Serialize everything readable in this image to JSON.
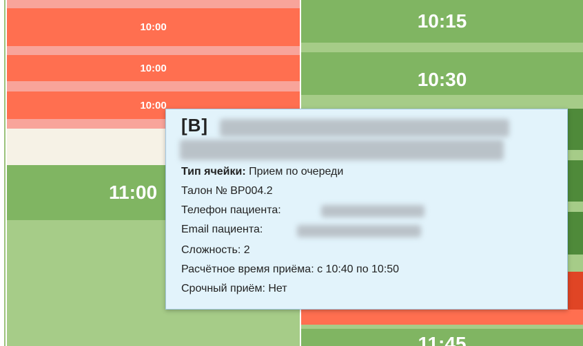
{
  "schedule": {
    "left_slots": [
      "10:00",
      "10:00",
      "10:00"
    ],
    "left_partial_time": "11:00",
    "right_slots": [
      "10:15",
      "10:30",
      "11:45"
    ]
  },
  "tooltip": {
    "title": "[В]",
    "cell_type_label": "Тип ячейки:",
    "cell_type_value": "Прием по очереди",
    "ticket": "Талон № ВР004.2",
    "phone_label": "Телефон пациента:",
    "email_label": "Email пациента:",
    "complexity": "Сложность: 2",
    "estimated_time": "Расчётное время приёма: с 10:40 по 10:50",
    "urgent": "Срочный приём: Нет"
  },
  "colors": {
    "slot_booked": "#ff6f50",
    "slot_free": "#80b562",
    "slot_urgent": "#e04525",
    "tooltip_bg": "#e2f3fb"
  }
}
